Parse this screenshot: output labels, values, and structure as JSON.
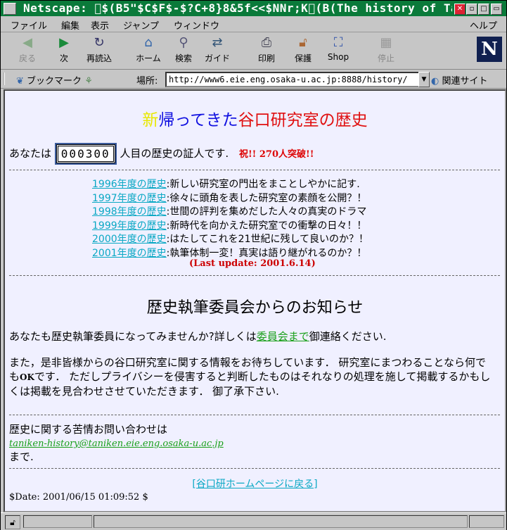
{
  "window": {
    "title": "Netscape: \u0000$(B5\"$C$F$-$?C+8}8&5f<<$NNr;K\u0000(B(The history of Tan"
  },
  "menu": [
    "ファイル",
    "編集",
    "表示",
    "ジャンプ",
    "ウィンドウ",
    "ヘルプ"
  ],
  "toolbar": {
    "back": "戻る",
    "forward": "次",
    "reload": "再読込",
    "home": "ホーム",
    "search": "検索",
    "guide": "ガイド",
    "print": "印刷",
    "security": "保護",
    "shop": "Shop",
    "stop": "停止",
    "logo": "N"
  },
  "location": {
    "bookmarks": "ブックマーク",
    "label": "場所:",
    "url": "http://www6.eie.eng.osaka-u.ac.jp:8888/history/",
    "related": "関連サイト"
  },
  "page": {
    "heading": {
      "new": "新",
      "returned": "帰ってきた",
      "lab_history": "谷口研究室の歴史"
    },
    "counter": {
      "prefix": "あなたは",
      "value": "000300",
      "suffix": "人目の歴史の証人です.",
      "celebrate": "祝!! 270人突破!!"
    },
    "history": [
      {
        "link": "1996年度の歴史",
        "desc": ":新しい研究室の門出をまことしやかに記す."
      },
      {
        "link": "1997年度の歴史",
        "desc": ":徐々に頭角を表した研究室の素顔を公開？！"
      },
      {
        "link": "1998年度の歴史",
        "desc": ":世間の評判を集めだした人々の真実のドラマ"
      },
      {
        "link": "1999年度の歴史",
        "desc": ":新時代を向かえた研究室での衝撃の日々！！"
      },
      {
        "link": "2000年度の歴史",
        "desc": ":はたしてこれを21世紀に残して良いのか？！"
      },
      {
        "link": "2001年度の歴史",
        "desc": ":執筆体制一変！真実は語り継がれるのか？！"
      }
    ],
    "last_update": "(Last update: 2001.6.14)",
    "notice_title": "歴史執筆委員会からのお知らせ",
    "para1": {
      "before": "あなたも歴史執筆委員になってみませんか?詳しくは",
      "link": "委員会まで",
      "after": "御連絡ください."
    },
    "para2": {
      "part1": "また，是非皆様からの谷口研究室に関する情報をお待ちしています． 研究室にまつわることなら何でも",
      "ok": "OK",
      "part2": "です． ただしプライバシーを侵害すると判断したものはそれなりの処理を施して掲載するかもしくは掲載を見合わせさせていただきます． 御了承下さい."
    },
    "contact": {
      "line1": "歴史に関する苦情お問い合わせは",
      "email": "taniken-history@taniken.eie.eng.osaka-u.ac.jp",
      "line2": "まで."
    },
    "home_link": "[谷口研ホームページに戻る]",
    "date": "$Date: 2001/06/15 01:09:52 $"
  }
}
